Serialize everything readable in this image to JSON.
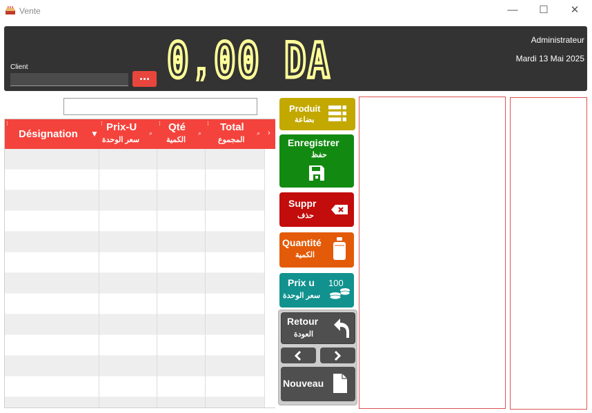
{
  "window": {
    "title": "Vente",
    "minimize_glyph": "—",
    "maximize_glyph": "☐",
    "close_glyph": "✕",
    "app_icon": "cake-icon"
  },
  "header": {
    "client_label": "Client",
    "client_value": "",
    "client_button_icon": "ellipsis-icon",
    "total_display": "0,00 DA",
    "user": "Administrateur",
    "date": "Mardi 13 Mai 2025"
  },
  "search": {
    "value": ""
  },
  "table": {
    "columns": [
      {
        "label": "Désignation",
        "sub": "",
        "icon": "filter-icon"
      },
      {
        "label": "Prix-U",
        "sub": "سعر الوحدة",
        "icon": "search-icon"
      },
      {
        "label": "Qté",
        "sub": "الكمية",
        "icon": "search-icon"
      },
      {
        "label": "Total",
        "sub": "المجموع",
        "icon": "search-icon"
      }
    ],
    "rows": []
  },
  "actions": {
    "produit": {
      "label": "Produit",
      "sub": "بضاعة",
      "icon": "list-icon"
    },
    "enregistrer": {
      "label": "Enregistrer",
      "sub": "حفظ",
      "icon": "floppy-disk-icon"
    },
    "suppr": {
      "label": "Suppr",
      "sub": "حذف",
      "icon": "backspace-icon"
    },
    "quantite": {
      "label": "Quantité",
      "sub": "الكمية",
      "icon": "weight-icon"
    },
    "prix_u": {
      "label": "Prix u",
      "sub": "سعر الوحدة",
      "icon": "coins-icon",
      "icon_text": "100"
    },
    "retour": {
      "label": "Retour",
      "sub": "العودة",
      "icon": "undo-arrow-icon"
    },
    "prev_icon": "chevron-left-icon",
    "next_icon": "chevron-right-icon",
    "nouveau": {
      "label": "Nouveau",
      "icon": "document-icon"
    }
  },
  "colors": {
    "accent_red": "#f4433c",
    "display_yellow": "#ffff99",
    "produit": "#c3a800",
    "enregistrer": "#128a12",
    "suppr": "#c30c0c",
    "quantite": "#e35b08",
    "prix_u": "#11928f",
    "nav_dark": "#4f4f4f"
  }
}
